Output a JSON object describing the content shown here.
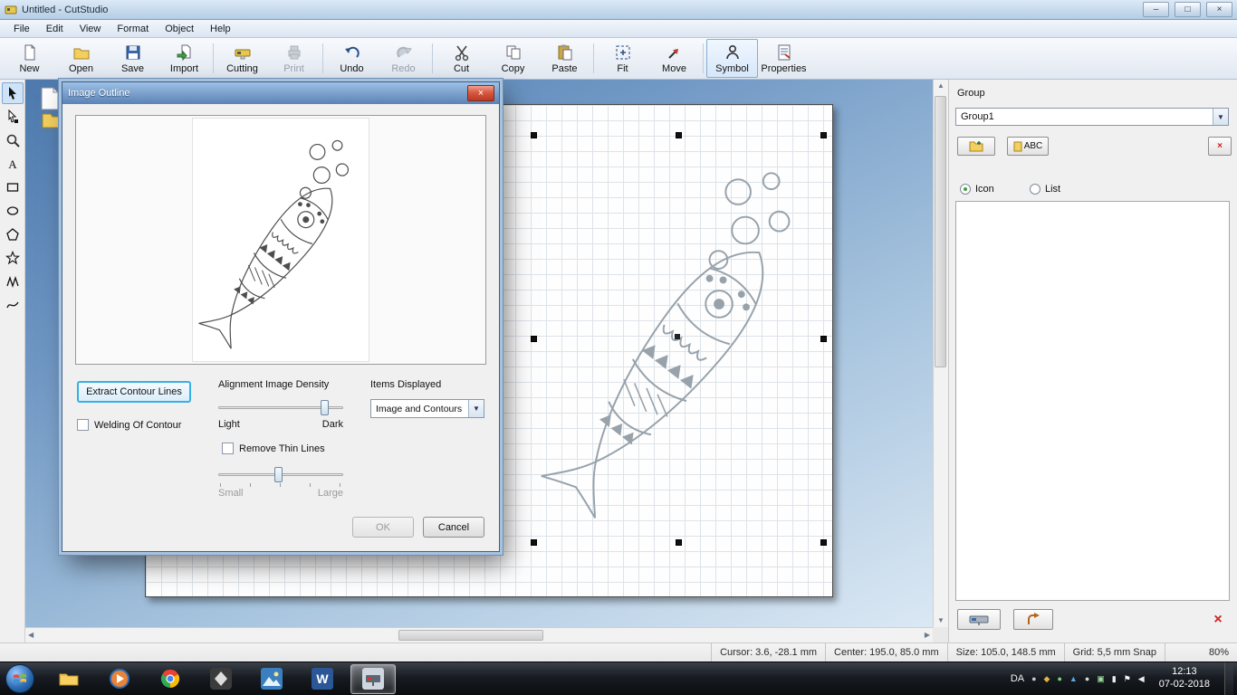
{
  "window": {
    "title": "Untitled - CutStudio",
    "controls": {
      "minimize": "–",
      "maximize": "□",
      "close": "×"
    }
  },
  "menu": {
    "items": [
      "File",
      "Edit",
      "View",
      "Format",
      "Object",
      "Help"
    ]
  },
  "toolbar": {
    "buttons": [
      {
        "label": "New"
      },
      {
        "label": "Open"
      },
      {
        "label": "Save"
      },
      {
        "label": "Import"
      },
      {
        "label": "Cutting"
      },
      {
        "label": "Print",
        "disabled": true
      },
      {
        "label": "Undo"
      },
      {
        "label": "Redo",
        "disabled": true
      },
      {
        "label": "Cut"
      },
      {
        "label": "Copy"
      },
      {
        "label": "Paste"
      },
      {
        "label": "Fit"
      },
      {
        "label": "Move"
      },
      {
        "label": "Symbol",
        "active": true
      },
      {
        "label": "Properties"
      }
    ]
  },
  "palette": {
    "tools": [
      "select",
      "node-edit",
      "zoom",
      "text",
      "rectangle",
      "ellipse",
      "polygon",
      "star",
      "polyline",
      "curve"
    ]
  },
  "dialog": {
    "title": "Image Outline",
    "close": "×",
    "extract_button": "Extract Contour Lines",
    "welding_checkbox": "Welding Of Contour",
    "density_label": "Alignment Image Density",
    "density_light": "Light",
    "density_dark": "Dark",
    "items_displayed_label": "Items Displayed",
    "items_displayed_value": "Image and Contours",
    "remove_thin_lines": "Remove Thin Lines",
    "size_small": "Small",
    "size_large": "Large",
    "ok": "OK",
    "cancel": "Cancel"
  },
  "right_panel": {
    "group_label": "Group",
    "group_value": "Group1",
    "abc_button": "ABC",
    "radio_icon": "Icon",
    "radio_list": "List",
    "delete_glyph": "×"
  },
  "status_bar": {
    "cursor": "Cursor: 3.6, -28.1 mm",
    "center": "Center: 195.0, 85.0 mm",
    "size": "Size: 105.0, 148.5 mm",
    "grid": "Grid: 5,5 mm Snap",
    "zoom": "80%"
  },
  "taskbar": {
    "language": "DA",
    "time": "12:13",
    "date": "07-02-2018",
    "apps": [
      {
        "name": "explorer"
      },
      {
        "name": "media-player"
      },
      {
        "name": "chrome"
      },
      {
        "name": "inkscape"
      },
      {
        "name": "photo-viewer"
      },
      {
        "name": "word"
      },
      {
        "name": "cutstudio",
        "active": true
      }
    ],
    "tray_icons": [
      {
        "name": "tray-app-1",
        "glyph": "●"
      },
      {
        "name": "tray-location",
        "glyph": "◆"
      },
      {
        "name": "tray-updater",
        "glyph": "●"
      },
      {
        "name": "tray-shield",
        "glyph": "▲"
      },
      {
        "name": "tray-sync",
        "glyph": "●"
      },
      {
        "name": "tray-display",
        "glyph": "▣"
      },
      {
        "name": "tray-battery",
        "glyph": "▮"
      },
      {
        "name": "tray-flag",
        "glyph": "⚑"
      },
      {
        "name": "tray-volume",
        "glyph": "◀"
      }
    ]
  }
}
